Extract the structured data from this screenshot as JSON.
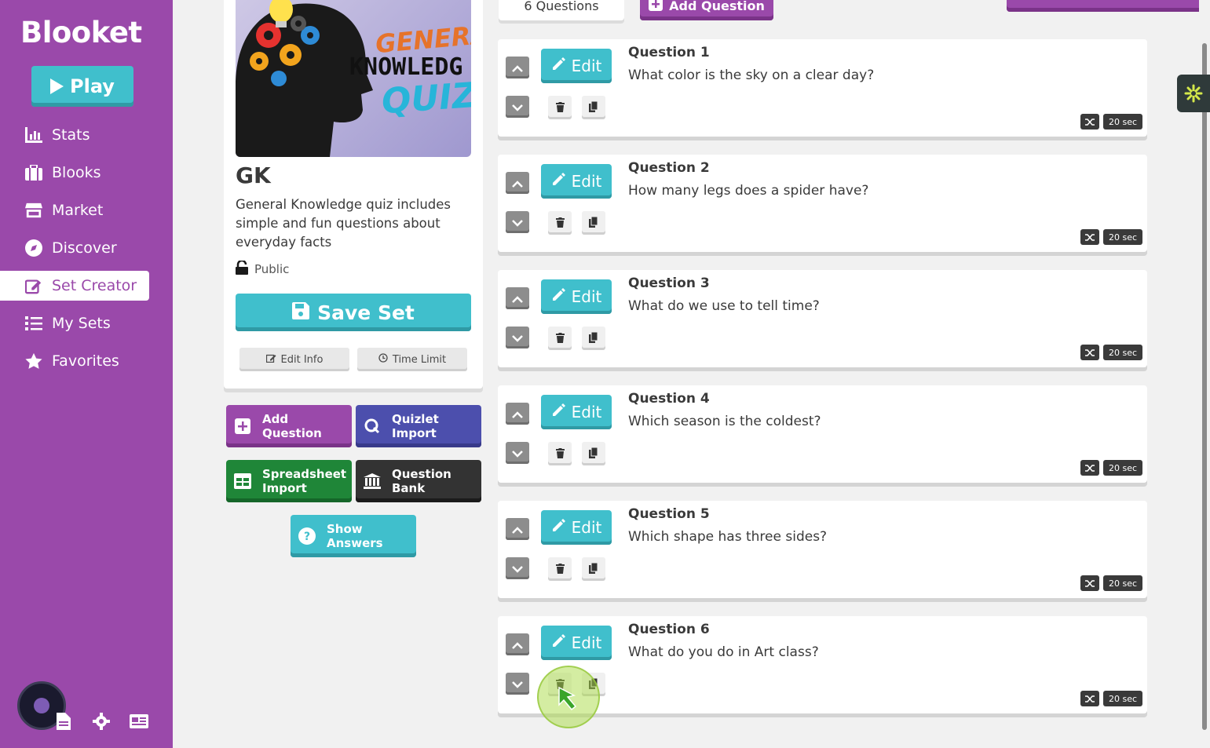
{
  "sidebar": {
    "logo": "Blooket",
    "play_label": "Play",
    "items": [
      {
        "label": "Stats",
        "icon": "stats-icon"
      },
      {
        "label": "Blooks",
        "icon": "blooks-icon"
      },
      {
        "label": "Market",
        "icon": "market-icon"
      },
      {
        "label": "Discover",
        "icon": "discover-icon"
      },
      {
        "label": "Set Creator",
        "icon": "set-creator-icon",
        "active": true
      },
      {
        "label": "My Sets",
        "icon": "list-icon"
      },
      {
        "label": "Favorites",
        "icon": "star-icon"
      }
    ]
  },
  "set": {
    "image_text": {
      "line1": "GENERAL",
      "line2": "KNOWLEDG",
      "line3": "QUIZ"
    },
    "title": "GK",
    "description": "General Knowledge quiz includes simple and fun questions about everyday facts",
    "visibility": "Public",
    "save_label": "Save Set",
    "edit_info_label": "Edit Info",
    "time_limit_label": "Time Limit"
  },
  "actions": {
    "add_question": "Add Question",
    "quizlet_import": "Quizlet Import",
    "spreadsheet_import": "Spreadsheet Import",
    "question_bank": "Question Bank",
    "show_answers": "Show Answers"
  },
  "header": {
    "question_count": "6 Questions",
    "add_question": "Add Question"
  },
  "questions": [
    {
      "number": "Question 1",
      "text": "What color is the sky on a clear day?",
      "time": "20 sec"
    },
    {
      "number": "Question 2",
      "text": "How many legs does a spider have?",
      "time": "20 sec"
    },
    {
      "number": "Question 3",
      "text": "What do we use to tell time?",
      "time": "20 sec"
    },
    {
      "number": "Question 4",
      "text": "Which season is the coldest?",
      "time": "20 sec"
    },
    {
      "number": "Question 5",
      "text": "Which shape has three sides?",
      "time": "20 sec"
    },
    {
      "number": "Question 6",
      "text": "What do you do in Art class?",
      "time": "20 sec"
    }
  ],
  "edit_label": "Edit",
  "colors": {
    "brand_purple": "#9a49aa",
    "teal": "#40bfcc",
    "quizlet_blue": "#4c4fad",
    "spreadsheet_green": "#1f8638"
  }
}
